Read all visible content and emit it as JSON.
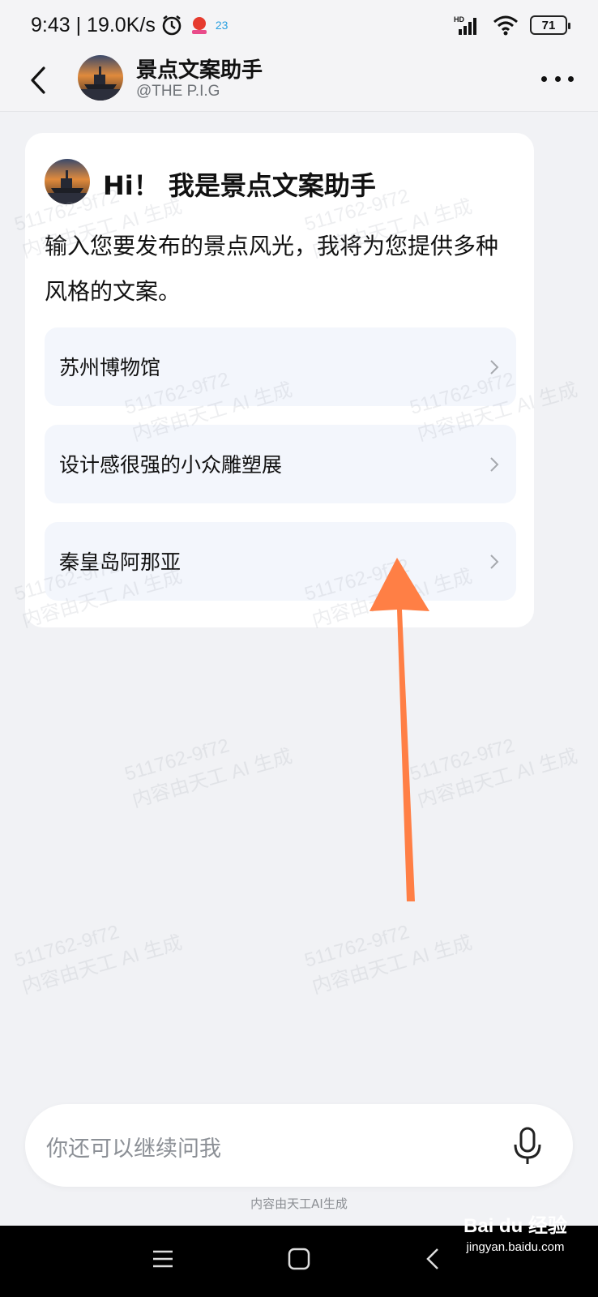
{
  "status_bar": {
    "time_speed": "9:43 | 19.0K/s",
    "notif_number": "23",
    "battery": "71",
    "network": "HD"
  },
  "header": {
    "title": "景点文案助手",
    "subtitle": "@THE P.I.G"
  },
  "card": {
    "title": "Hi！ 我是景点文案助手",
    "description": "输入您要发布的景点风光，我将为您提供多种风格的文案。",
    "suggestions": [
      {
        "label": "苏州博物馆"
      },
      {
        "label": "设计感很强的小众雕塑展"
      },
      {
        "label": "秦皇岛阿那亚"
      }
    ]
  },
  "watermark": {
    "line1": "511762-9f72",
    "line2": "内容由天工 AI 生成"
  },
  "input": {
    "placeholder": "你还可以继续问我"
  },
  "disclaimer": "内容由天工AI生成",
  "baidu_watermark": {
    "brand": "Bai du 经验",
    "url": "jingyan.baidu.com"
  },
  "colors": {
    "background": "#f1f2f5",
    "card": "#ffffff",
    "suggestion_bg": "#f3f6fc",
    "arrow": "#ff7f45",
    "nav_bar": "#000000"
  }
}
